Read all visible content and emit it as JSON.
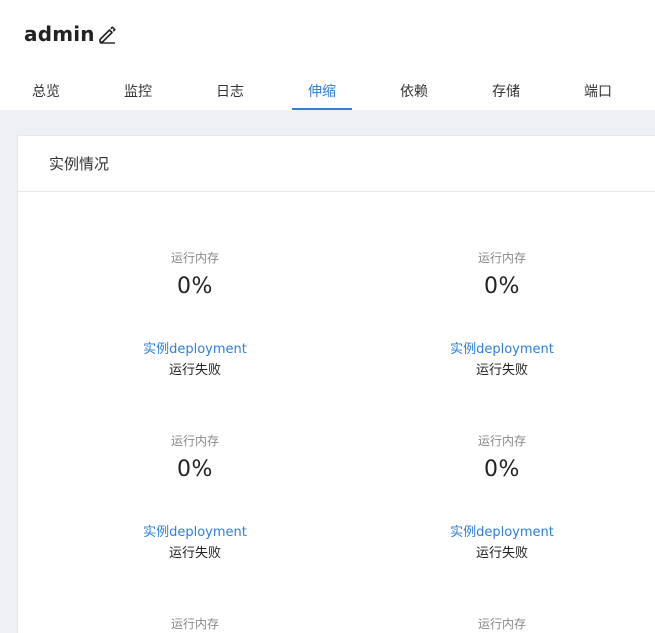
{
  "header": {
    "title": "admin",
    "edit_icon": "pencil-icon"
  },
  "tabs": [
    {
      "label": "总览",
      "active": false
    },
    {
      "label": "监控",
      "active": false
    },
    {
      "label": "日志",
      "active": false
    },
    {
      "label": "伸缩",
      "active": true
    },
    {
      "label": "依赖",
      "active": false
    },
    {
      "label": "存储",
      "active": false
    },
    {
      "label": "端口",
      "active": false
    }
  ],
  "colors": {
    "accent": "#2f80d8",
    "background": "#eef0f4"
  },
  "card": {
    "title": "实例情况",
    "instances": [
      {
        "metric_label": "运行内存",
        "metric_value": "0%",
        "link": "实例deployment",
        "status": "运行失败"
      },
      {
        "metric_label": "运行内存",
        "metric_value": "0%",
        "link": "实例deployment",
        "status": "运行失败"
      },
      {
        "metric_label": "运行内存",
        "metric_value": "0%",
        "link": "实例deployment",
        "status": "运行失败"
      },
      {
        "metric_label": "运行内存",
        "metric_value": "0%",
        "link": "实例deployment",
        "status": "运行失败"
      },
      {
        "metric_label": "运行内存"
      },
      {
        "metric_label": "运行内存"
      }
    ]
  }
}
